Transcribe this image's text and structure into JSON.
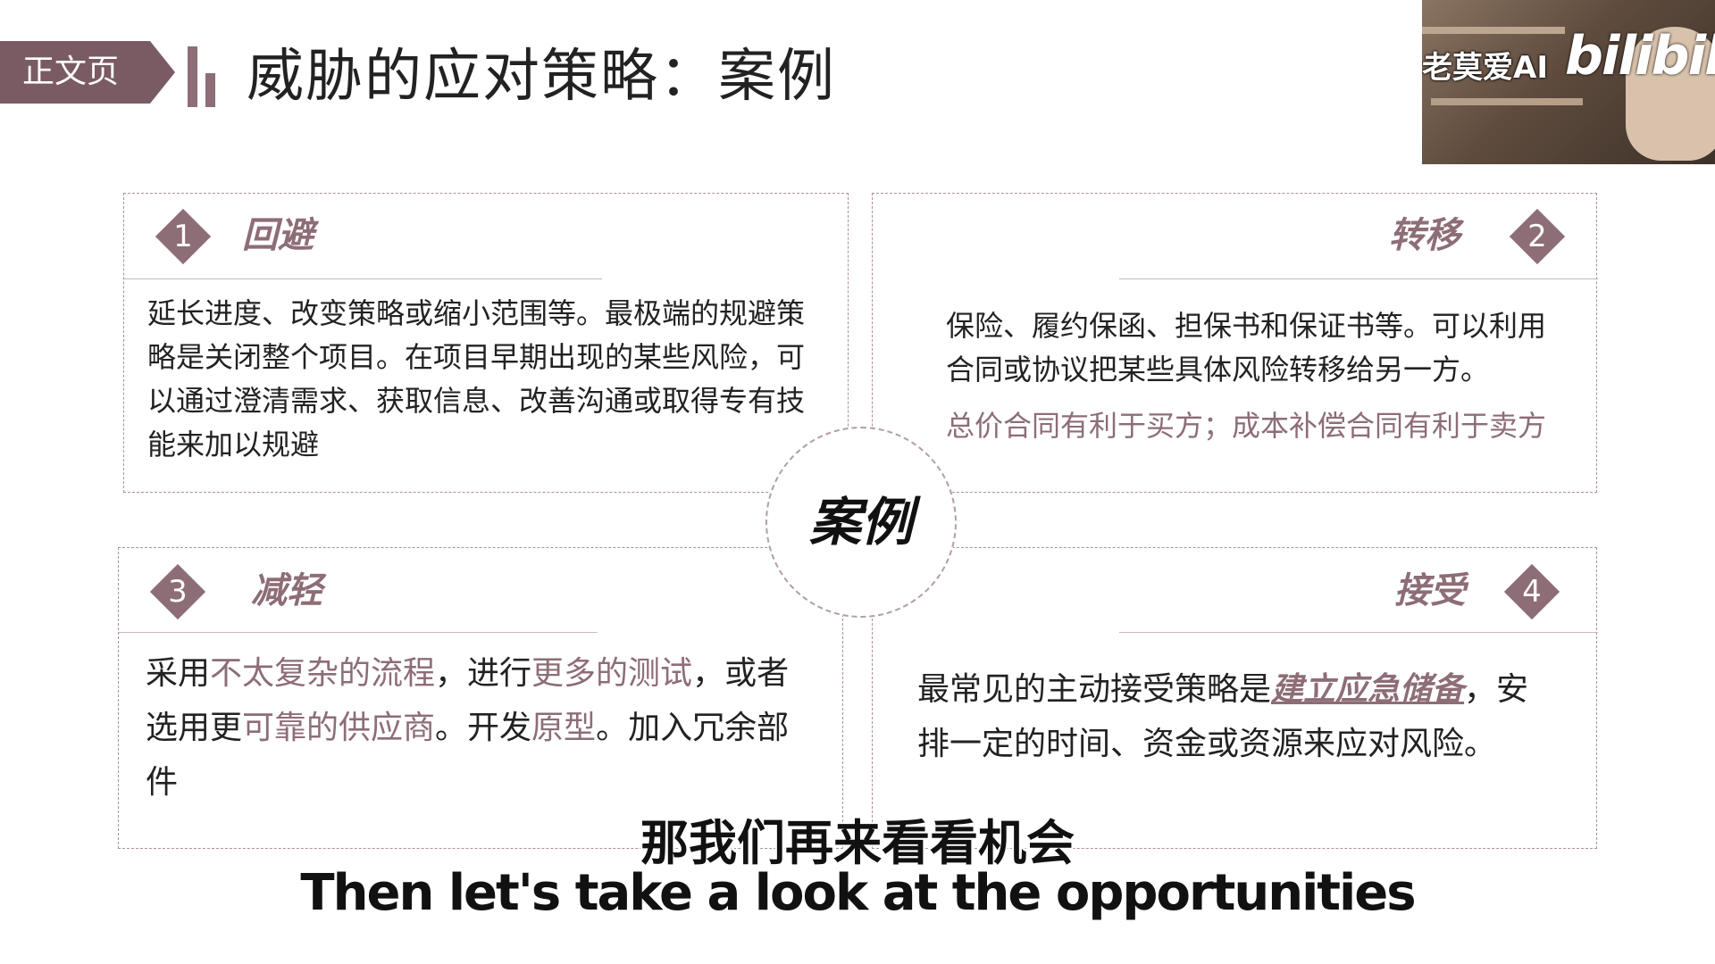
{
  "header": {
    "tag_label": "正文页",
    "page_title": "威胁的应对策略：案例"
  },
  "watermark": {
    "channel": "老莫爱AI",
    "logo": "bilibili"
  },
  "center": {
    "label": "案例"
  },
  "boxes": [
    {
      "number": "1",
      "title": "回避",
      "text": "延长进度、改变策略或缩小范围等。最极端的规避策略是关闭整个项目。在项目早期出现的某些风险，可以通过澄清需求、获取信息、改善沟通或取得专有技能来加以规避"
    },
    {
      "number": "2",
      "title": "转移",
      "text": "保险、履约保函、担保书和保证书等。可以利用合同或协议把某些具体风险转移给另一方。",
      "note": "总价合同有利于买方；成本补偿合同有利于卖方"
    },
    {
      "number": "3",
      "title": "减轻",
      "segments": [
        "采用",
        "不太复杂的流程",
        "，进行",
        "更多的测试",
        "，或者选用更",
        "可靠的供应商",
        "。开发",
        "原型",
        "。加入冗余部件"
      ]
    },
    {
      "number": "4",
      "title": "接受",
      "segments": [
        "最常见的主动接受策略是",
        "建立应急储备",
        "，安排一定的时间、资金或资源来应对风险。"
      ]
    }
  ],
  "subtitles": {
    "cn": "那我们再来看看机会",
    "en": "Then let's take a look at the opportunities"
  },
  "colors": {
    "accent": "#8d6d76",
    "tag_bg": "#7a5b64"
  }
}
